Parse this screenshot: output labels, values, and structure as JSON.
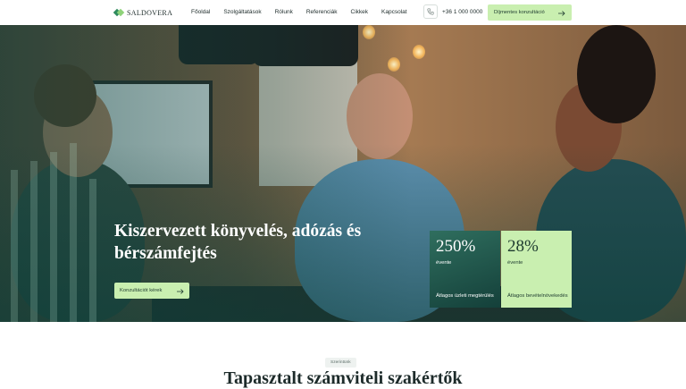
{
  "brand": {
    "name": "SALDOVERA",
    "accent": "#c9efb0",
    "dark": "#14403a"
  },
  "nav": {
    "items": [
      "Főoldal",
      "Szolgáltatások",
      "Rólunk",
      "Referenciák",
      "Cikkek",
      "Kapcsolat"
    ]
  },
  "header": {
    "phone": "+36 1 000 0000",
    "cta_label": "Díjmentes konzultáció"
  },
  "hero": {
    "title": "Kiszervezett könyvelés, adózás és bérszámfejtés",
    "cta_label": "Konzultációt kérek",
    "stats": [
      {
        "value": "250%",
        "period": "évente",
        "desc": "Átlagos üzleti megtérülés"
      },
      {
        "value": "28%",
        "period": "évente",
        "desc": "Átlagos bevételnövekedés"
      }
    ]
  },
  "section": {
    "badge": "Szerintünk",
    "title": "Tapasztalt számviteli szakértők"
  },
  "icons": {
    "phone": "phone-icon",
    "arrow": "arrow-right-icon",
    "logo": "logo-icon"
  }
}
